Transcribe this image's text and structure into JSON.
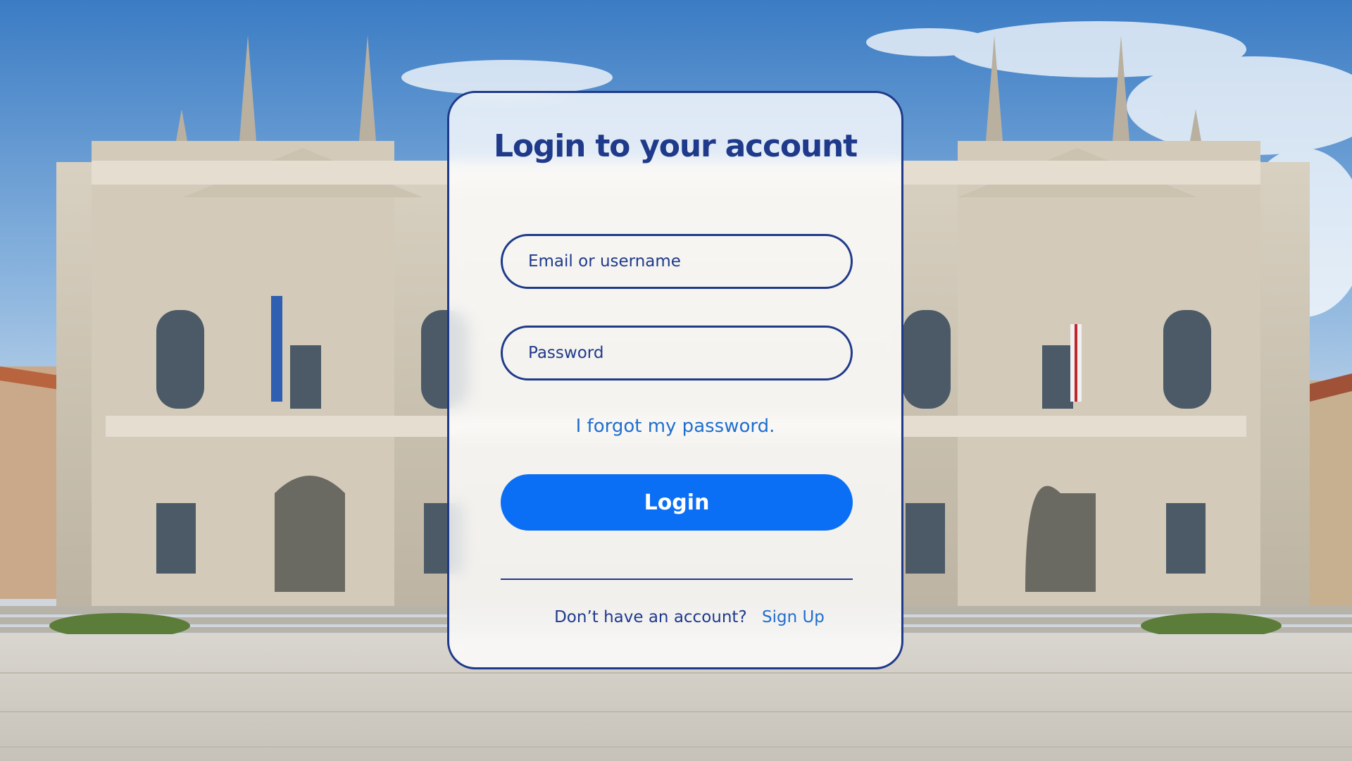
{
  "login": {
    "title": "Login to your account",
    "email_placeholder": "Email or username",
    "password_placeholder": "Password",
    "forgot_link": "I forgot my password.",
    "login_button": "Login",
    "no_account_text": "Don’t have an account?",
    "signup_link": "Sign Up"
  },
  "colors": {
    "primary_navy": "#1f3a8a",
    "button_blue": "#0a6ff5",
    "link_blue": "#1f6fcf"
  },
  "background": {
    "description_icon": "building-photo"
  }
}
